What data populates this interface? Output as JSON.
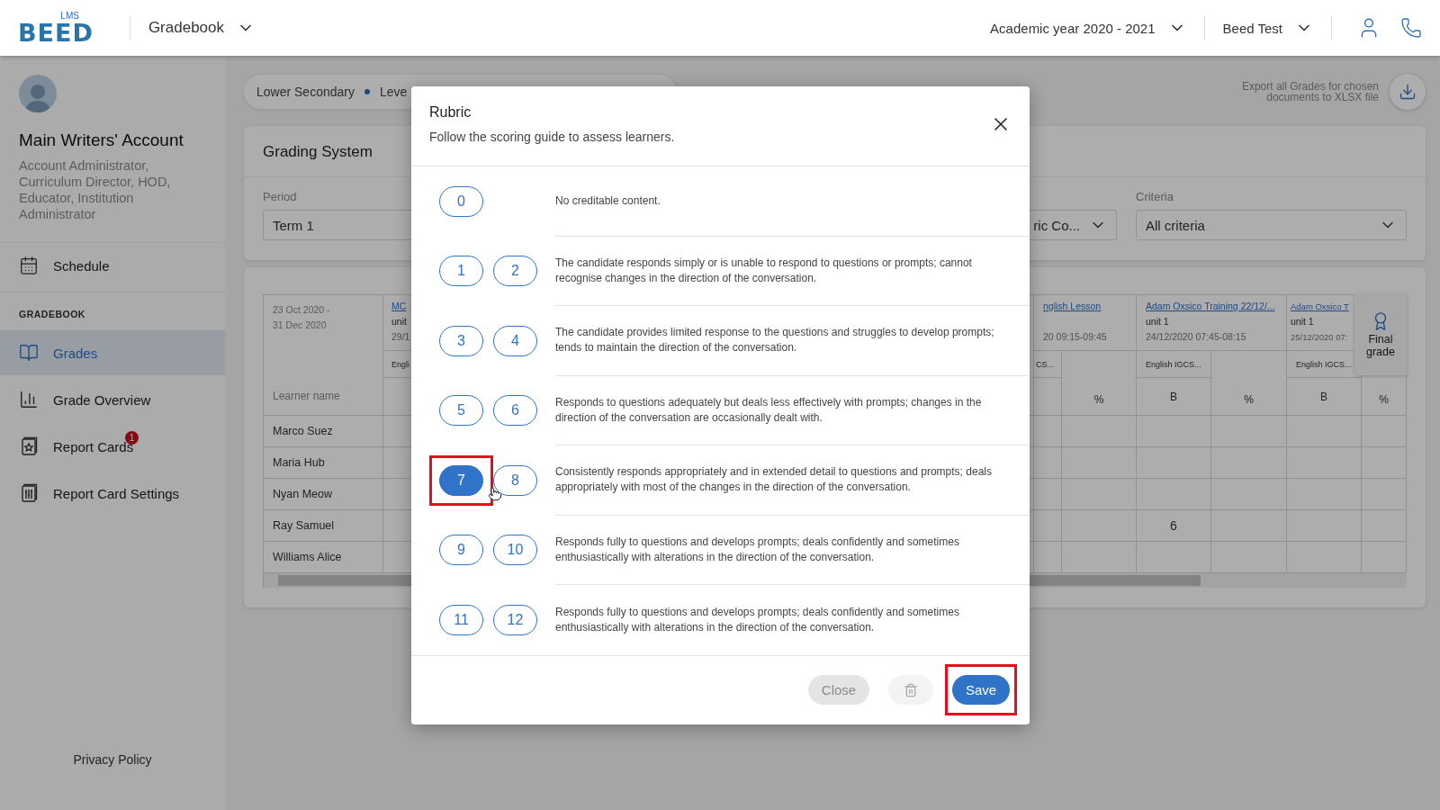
{
  "header": {
    "logo_badge": "LMS",
    "logo_text": "BEED",
    "app_menu": "Gradebook",
    "academic_year": "Academic year 2020 - 2021",
    "school": "Beed Test"
  },
  "sidebar": {
    "user_name": "Main Writers' Account",
    "user_roles": "Account Administrator, Curriculum Director, HOD, Educator, Institution Administrator",
    "top_items": [
      {
        "label": "Schedule",
        "selected": false
      }
    ],
    "section_title": "GRADEBOOK",
    "items": [
      {
        "label": "Grades",
        "selected": true
      },
      {
        "label": "Grade Overview",
        "selected": false
      },
      {
        "label": "Report Cards",
        "selected": false,
        "badge": "1"
      },
      {
        "label": "Report Card Settings",
        "selected": false
      }
    ],
    "footer_link": "Privacy Policy"
  },
  "breadcrumb": [
    "Lower Secondary",
    "Leve"
  ],
  "export_hint": "Export all Grades for chosen documents to XLSX file",
  "grading": {
    "title": "Grading System",
    "filters": [
      {
        "label": "Period",
        "value": "Term 1"
      },
      {
        "value": "ric Co..."
      },
      {
        "label": "Criteria",
        "value": "All criteria"
      }
    ]
  },
  "table": {
    "date_range": [
      "23 Oct 2020 -",
      "31 Dec 2020"
    ],
    "learner_heading": "Learner name",
    "learners": [
      {
        "name": "Marco Suez"
      },
      {
        "name": "Maria Hub"
      },
      {
        "name": "Nyan Meow"
      },
      {
        "name": "Ray Samuel",
        "grade_cells": [
          {
            "kind": "blank"
          },
          {
            "kind": "mark",
            "value": "6"
          },
          {
            "kind": "blank"
          }
        ]
      },
      {
        "name": "Williams Alice"
      }
    ],
    "partial_column": {
      "title": "MC",
      "unit": "unit",
      "date": "29/1",
      "criterion": "Engli"
    },
    "groups": [
      {
        "title": "nglish Lesson",
        "date": "20 09:15-09:45",
        "criterion": "CS...",
        "percent_heading": "%"
      },
      {
        "title": "Adam Oxsico Training 22/12/...",
        "unit": "unit 1",
        "date": "24/12/2020 07:45-08:15",
        "criterion": "English IGCS...",
        "grade_heading": "B",
        "percent_heading": "%"
      },
      {
        "title": "Adam Oxsico T",
        "unit": "unit 1",
        "date": "25/12/2020 07:",
        "criterion": "English IGCS...",
        "grade_heading": "B",
        "percent_heading": "%"
      }
    ],
    "final_grade": "Final grade"
  },
  "modal": {
    "title": "Rubric",
    "subtitle": "Follow the scoring guide to assess learners.",
    "levels": [
      {
        "scores": [
          {
            "label": "0",
            "selected": false,
            "highlighted": false
          }
        ],
        "description": "No creditable content."
      },
      {
        "scores": [
          {
            "label": "1",
            "selected": false,
            "highlighted": false
          },
          {
            "label": "2",
            "selected": false,
            "highlighted": false
          }
        ],
        "description": "The candidate responds simply or is unable to respond to questions or prompts; cannot recognise changes in the direction of the conversation."
      },
      {
        "scores": [
          {
            "label": "3",
            "selected": false,
            "highlighted": false
          },
          {
            "label": "4",
            "selected": false,
            "highlighted": false
          }
        ],
        "description": "The candidate provides limited response to the questions and struggles to develop prompts; tends to maintain the direction of the conversation."
      },
      {
        "scores": [
          {
            "label": "5",
            "selected": false,
            "highlighted": false
          },
          {
            "label": "6",
            "selected": false,
            "highlighted": false
          }
        ],
        "description": "Responds to questions adequately but deals less effectively with prompts; changes in the direction of the conversation are occasionally dealt with."
      },
      {
        "scores": [
          {
            "label": "7",
            "selected": true,
            "highlighted": true
          },
          {
            "label": "8",
            "selected": false,
            "highlighted": false
          }
        ],
        "description": "Consistently responds appropriately and in extended detail to questions and prompts; deals appropriately with most of the changes in the direction of the conversation."
      },
      {
        "scores": [
          {
            "label": "9",
            "selected": false,
            "highlighted": false
          },
          {
            "label": "10",
            "selected": false,
            "highlighted": false
          }
        ],
        "description": "Responds fully to questions and develops prompts; deals confidently and sometimes enthusiastically with alterations in the direction of the conversation."
      },
      {
        "scores": [
          {
            "label": "11",
            "selected": false,
            "highlighted": false
          },
          {
            "label": "12",
            "selected": false,
            "highlighted": false
          }
        ],
        "description": "Responds fully to questions and develops prompts; deals confidently and sometimes enthusiastically with alterations in the direction of the conversation."
      }
    ],
    "close_button": {
      "label": "Close",
      "disabled": true
    },
    "delete_button": {
      "disabled": true
    },
    "save_button": {
      "label": "Save",
      "highlighted": true
    }
  }
}
